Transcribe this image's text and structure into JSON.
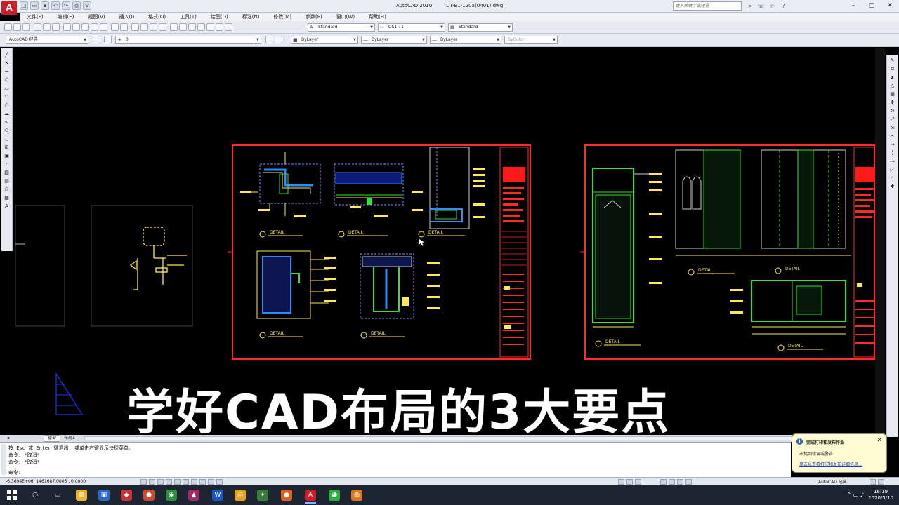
{
  "app": {
    "logo": "A",
    "title": "AutoCAD 2010",
    "file_name": "DT-B1-1205(0401).dwg",
    "help_search_placeholder": "键入关键字或短语"
  },
  "menus": [
    "文件(F)",
    "编辑(E)",
    "视图(V)",
    "插入(I)",
    "格式(O)",
    "工具(T)",
    "绘图(D)",
    "标注(N)",
    "修改(M)",
    "参数(P)",
    "窗口(W)",
    "帮助(H)"
  ],
  "toolbar": {
    "text_style": "Standard",
    "dim_style": "DS1 : 1",
    "table_style": "Standard",
    "workspace": "AutoCAD 经典",
    "layer": "0",
    "color": "ByLayer",
    "linetype": "ByLayer",
    "lineweight": "ByLayer",
    "plot_style": "ByColor"
  },
  "drawing": {
    "sheet1_details": [
      "DETAIL",
      "DETAIL",
      "DETAIL",
      "DETAIL",
      "DETAIL"
    ],
    "sheet2_details": [
      "DETAIL",
      "DETAIL",
      "DETAIL",
      "DETAIL"
    ]
  },
  "caption": "学好CAD布局的3大要点",
  "layout_tabs": [
    "模型",
    "布局1"
  ],
  "command": {
    "line1": "按 Esc 或 Enter 键退出, 或单击右键显示快捷菜单。",
    "line2": "命令: *取消*",
    "line3": "命令: *取消*",
    "prompt": "命令:"
  },
  "status": {
    "coords": "-6.3694E+06, 1461687.0005 , 0.0000",
    "workspace": "AutoCAD 经典"
  },
  "notification": {
    "title": "完成打印和发布作业",
    "message": "未找到错误或警告",
    "link": "单击以查看打印和发布详细信息..."
  },
  "taskbar": {
    "time": "16:19",
    "date": "2020/5/10"
  }
}
